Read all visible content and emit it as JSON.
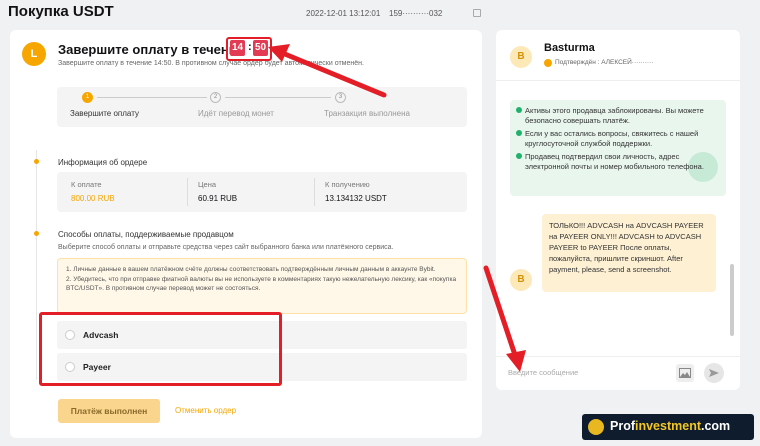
{
  "header": {
    "title": "Покупка USDT",
    "timestamp": "2022-12-01 13:12:01",
    "order_id": "159··········032"
  },
  "timer": {
    "title": "Завершите оплату в течение",
    "minutes": "14",
    "seconds": "50",
    "note": "Завершите оплату в течение 14:50. В противном случае ордер будет автоматически отменён."
  },
  "steps": [
    {
      "num": "1",
      "label": "Завершите оплату",
      "active": true
    },
    {
      "num": "2",
      "label": "Идёт перевод монет",
      "active": false
    },
    {
      "num": "3",
      "label": "Транзакция выполнена",
      "active": false
    }
  ],
  "order_info": {
    "section_title": "Информация об ордере",
    "pay_label": "К оплате",
    "pay_value": "800.00 RUB",
    "price_label": "Цена",
    "price_value": "60.91 RUB",
    "receive_label": "К получению",
    "receive_value": "13.134132 USDT"
  },
  "payment": {
    "section_title": "Способы оплаты, поддерживаемые продавцом",
    "subtitle": "Выберите способ оплаты и отправьте средства через сайт выбранного банка или платёжного сервиса.",
    "warning_1": "1. Личные данные в вашем платёжном счёте должны соответствовать подтверждённым личным данным в аккаунте Bybit.",
    "warning_2": "2. Убедитесь, что при отправке фиатной валюты вы не используете в комментариях такую нежелательную лексику, как «покупка BTC/USDT». В противном случае перевод может не состояться.",
    "methods": [
      "Advcash",
      "Payeer"
    ]
  },
  "actions": {
    "paid_label": "Платёж выполнен",
    "cancel_label": "Отменить ордер"
  },
  "merchant": {
    "avatar": "B",
    "name": "Basturma",
    "verified": "Подтверждён : АЛЕКСЕЙ··········"
  },
  "chat": {
    "notices": [
      "Активы этого продавца заблокированы. Вы можете безопасно совершать платёж.",
      "Если у вас остались вопросы, свяжитесь с нашей круглосуточной службой поддержки.",
      "Продавец подтвердил свои личность, адрес электронной почты и номер мобильного телефона."
    ],
    "message": "ТОЛЬКО!!! ADVCASH на ADVCASH PAYEER на PAYEER ONLY!!! ADVCASH to ADVCASH PAYEER to PAYEER После оплаты, пожалуйста, пришлите скриншот. After payment, please, send a screenshot.",
    "input_placeholder": "Введите сообщение"
  },
  "watermark": {
    "prefix": "Prof",
    "highlight": "investment",
    "suffix": ".com"
  },
  "colors": {
    "accent": "#f7a600",
    "timer": "#e33b54",
    "annotation": "#e41e26",
    "notice_bg": "#e8f6ee"
  }
}
